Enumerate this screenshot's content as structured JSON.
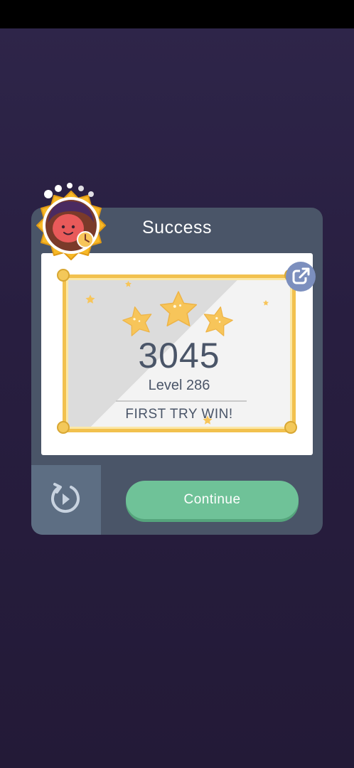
{
  "dialog": {
    "title": "Success",
    "score": "3045",
    "level_label": "Level 286",
    "result_label": "FIRST TRY WIN!",
    "stars_earned": 3,
    "stars_total": 3
  },
  "actions": {
    "continue_label": "Continue",
    "share_icon": "share-external-icon",
    "retry_icon": "replay-icon"
  },
  "colors": {
    "background": "#241b3a",
    "dialog": "#4a5568",
    "continue_button": "#6fc298",
    "star": "#f7c55a",
    "frame": "#f2c14e",
    "share_button": "#7c8fbe"
  }
}
